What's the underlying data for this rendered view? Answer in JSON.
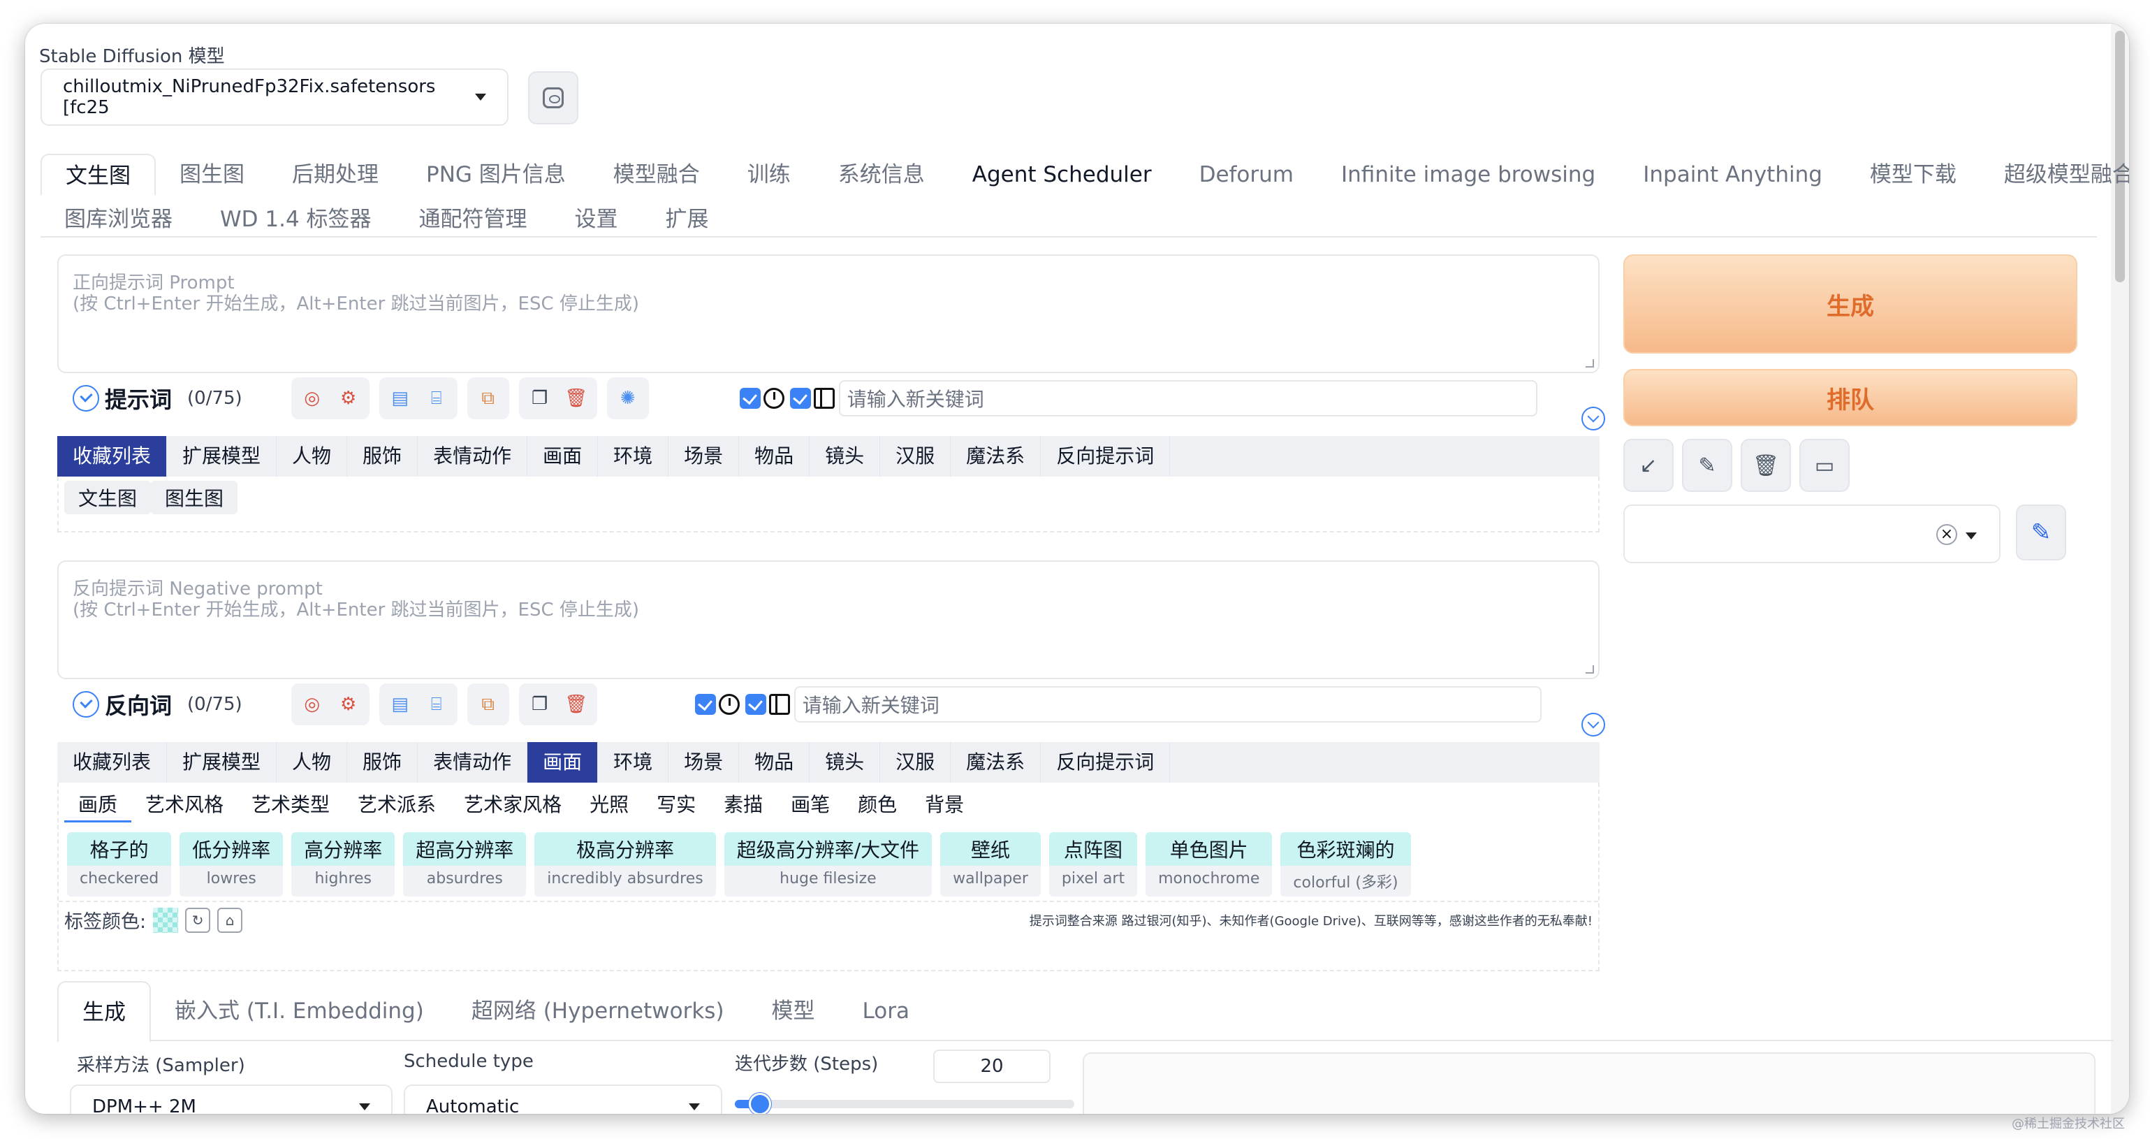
{
  "model": {
    "label": "Stable Diffusion 模型",
    "selected": "chilloutmix_NiPrunedFp32Fix.safetensors [fc25"
  },
  "main_tabs_row1": [
    "文生图",
    "图生图",
    "后期处理",
    "PNG 图片信息",
    "模型融合",
    "训练",
    "系统信息",
    "Agent Scheduler",
    "Deforum",
    "Infinite image browsing",
    "Inpaint Anything",
    "模型下载",
    "超级模型融合"
  ],
  "main_tabs_row2": [
    "图库浏览器",
    "WD 1.4 标签器",
    "通配符管理",
    "设置",
    "扩展"
  ],
  "prompt": {
    "placeholder_line1": "正向提示词 Prompt",
    "placeholder_line2": "(按 Ctrl+Enter 开始生成，Alt+Enter 跳过当前图片，ESC 停止生成)",
    "title": "提示词",
    "count": "(0/75)",
    "keyword_placeholder": "请输入新关键词"
  },
  "negative": {
    "placeholder_line1": "反向提示词 Negative prompt",
    "placeholder_line2": "(按 Ctrl+Enter 开始生成，Alt+Enter 跳过当前图片，ESC 停止生成)",
    "title": "反向词",
    "count": "(0/75)",
    "keyword_placeholder": "请输入新关键词"
  },
  "categories": [
    "收藏列表",
    "扩展模型",
    "人物",
    "服饰",
    "表情动作",
    "画面",
    "环境",
    "场景",
    "物品",
    "镜头",
    "汉服",
    "魔法系",
    "反向提示词"
  ],
  "prompt_subtabs": [
    "文生图",
    "图生图"
  ],
  "negative_subtabs": [
    "画质",
    "艺术风格",
    "艺术类型",
    "艺术派系",
    "艺术家风格",
    "光照",
    "写实",
    "素描",
    "画笔",
    "颜色",
    "背景"
  ],
  "tags": [
    {
      "zh": "格子的",
      "en": "checkered"
    },
    {
      "zh": "低分辨率",
      "en": "lowres"
    },
    {
      "zh": "高分辨率",
      "en": "highres"
    },
    {
      "zh": "超高分辨率",
      "en": "absurdres"
    },
    {
      "zh": "极高分辨率",
      "en": "incredibly absurdres"
    },
    {
      "zh": "超级高分辨率/大文件",
      "en": "huge filesize"
    },
    {
      "zh": "壁纸",
      "en": "wallpaper"
    },
    {
      "zh": "点阵图",
      "en": "pixel art"
    },
    {
      "zh": "单色图片",
      "en": "monochrome"
    },
    {
      "zh": "色彩斑斓的",
      "en": "colorful (多彩)"
    }
  ],
  "tag_color_label": "标签颜色:",
  "credit": "提示词整合来源 路过银河(知乎)、未知作者(Google Drive)、互联网等等，感谢这些作者的无私奉献!",
  "bottom_tabs": [
    "生成",
    "嵌入式 (T.I. Embedding)",
    "超网络 (Hypernetworks)",
    "模型",
    "Lora"
  ],
  "sampler": {
    "label": "采样方法 (Sampler)",
    "value": "DPM++ 2M"
  },
  "schedule": {
    "label": "Schedule type",
    "value": "Automatic"
  },
  "steps": {
    "label": "迭代步数 (Steps)",
    "value": "20",
    "fraction": 0.075
  },
  "buttons": {
    "generate": "生成",
    "queue": "排队"
  },
  "side_icons": [
    "arrow-down-left-icon",
    "note-icon",
    "trash-icon",
    "clipboard-icon"
  ],
  "watermark": "@稀土掘金技术社区",
  "colors": {
    "accent": "#3b82f6",
    "generate_text": "#e06c2b",
    "active_category": "#2c3e9b",
    "tag_bg": "#c9f4f1"
  }
}
